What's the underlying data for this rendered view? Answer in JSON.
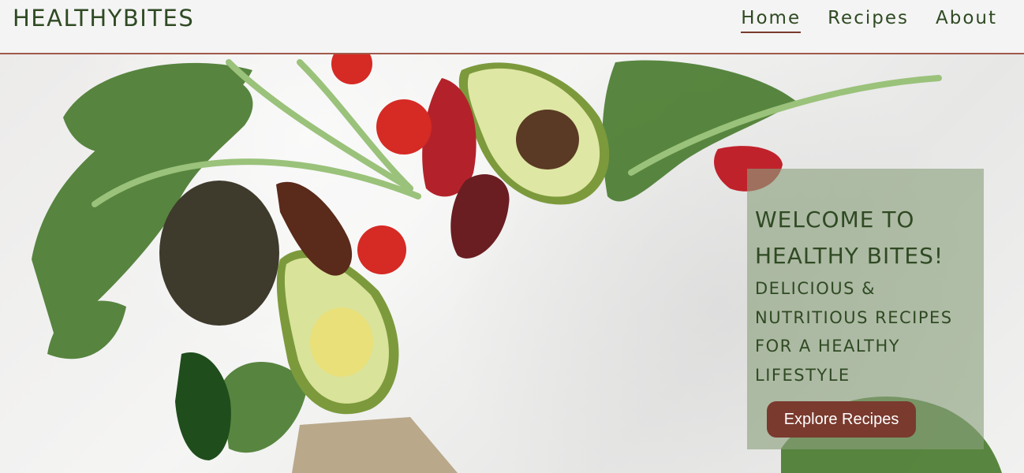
{
  "header": {
    "logo": "HEALTHYBITES",
    "nav": [
      {
        "label": "Home",
        "active": true
      },
      {
        "label": "Recipes",
        "active": false
      },
      {
        "label": "About",
        "active": false
      }
    ]
  },
  "hero": {
    "image_description_icon": "vegetables-photo",
    "welcome_title": "WELCOME TO HEALTHY BITES!",
    "welcome_subtitle": "DELICIOUS & NUTRITIOUS RECIPES FOR A HEALTHY LIFESTYLE",
    "cta_label": "Explore Recipes"
  },
  "colors": {
    "brand_green": "#2f4a23",
    "cta_brown": "#7a3a2e",
    "overlay_green": "#8aa07c"
  }
}
